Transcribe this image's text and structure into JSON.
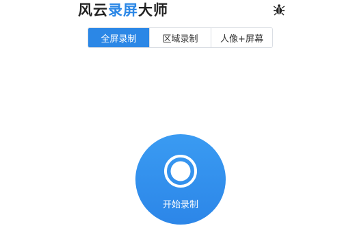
{
  "header": {
    "title_part1": "风云",
    "title_part2": "录屏",
    "title_part3": "大师",
    "settings_icon": "bug-icon"
  },
  "tabs": [
    {
      "label": "全屏录制",
      "active": true
    },
    {
      "label": "区域录制",
      "active": false
    },
    {
      "label": "人像+屏幕",
      "active": false
    }
  ],
  "record": {
    "label": "开始录制",
    "icon": "record-circle-icon"
  },
  "colors": {
    "accent": "#2b87e6",
    "title_dark": "#222222",
    "tab_border": "#d9dde3",
    "background": "#ffffff"
  }
}
